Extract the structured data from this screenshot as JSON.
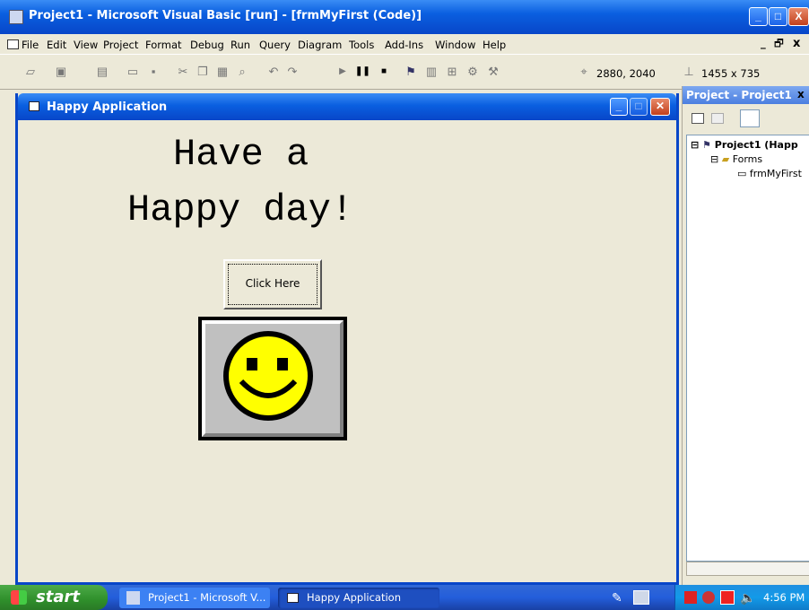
{
  "main_window": {
    "title": "Project1 - Microsoft Visual Basic [run] - [frmMyFirst (Code)]",
    "min_label": "_",
    "max_label": "□",
    "close_label": "X"
  },
  "menu": {
    "items": [
      "File",
      "Edit",
      "View",
      "Project",
      "Format",
      "Debug",
      "Run",
      "Query",
      "Diagram",
      "Tools",
      "Add-Ins",
      "Window",
      "Help"
    ],
    "mdi_min": "_",
    "mdi_restore": "🗗",
    "mdi_close": "x"
  },
  "toolbar": {
    "position": "2880, 2040",
    "size": "1455 x 735"
  },
  "child_window": {
    "title": "Happy Application",
    "line1": "Have a",
    "line2": "Happy day!",
    "button_label": "Click Here"
  },
  "project_panel": {
    "title": "Project - Project1",
    "close": "x",
    "tree": {
      "project": "Project1 (Happ",
      "folder": "Forms",
      "form": "frmMyFirst"
    }
  },
  "taskbar": {
    "start_label": "start",
    "items": [
      "Project1 - Microsoft V...",
      "Happy Application"
    ],
    "clock": "4:56 PM"
  }
}
